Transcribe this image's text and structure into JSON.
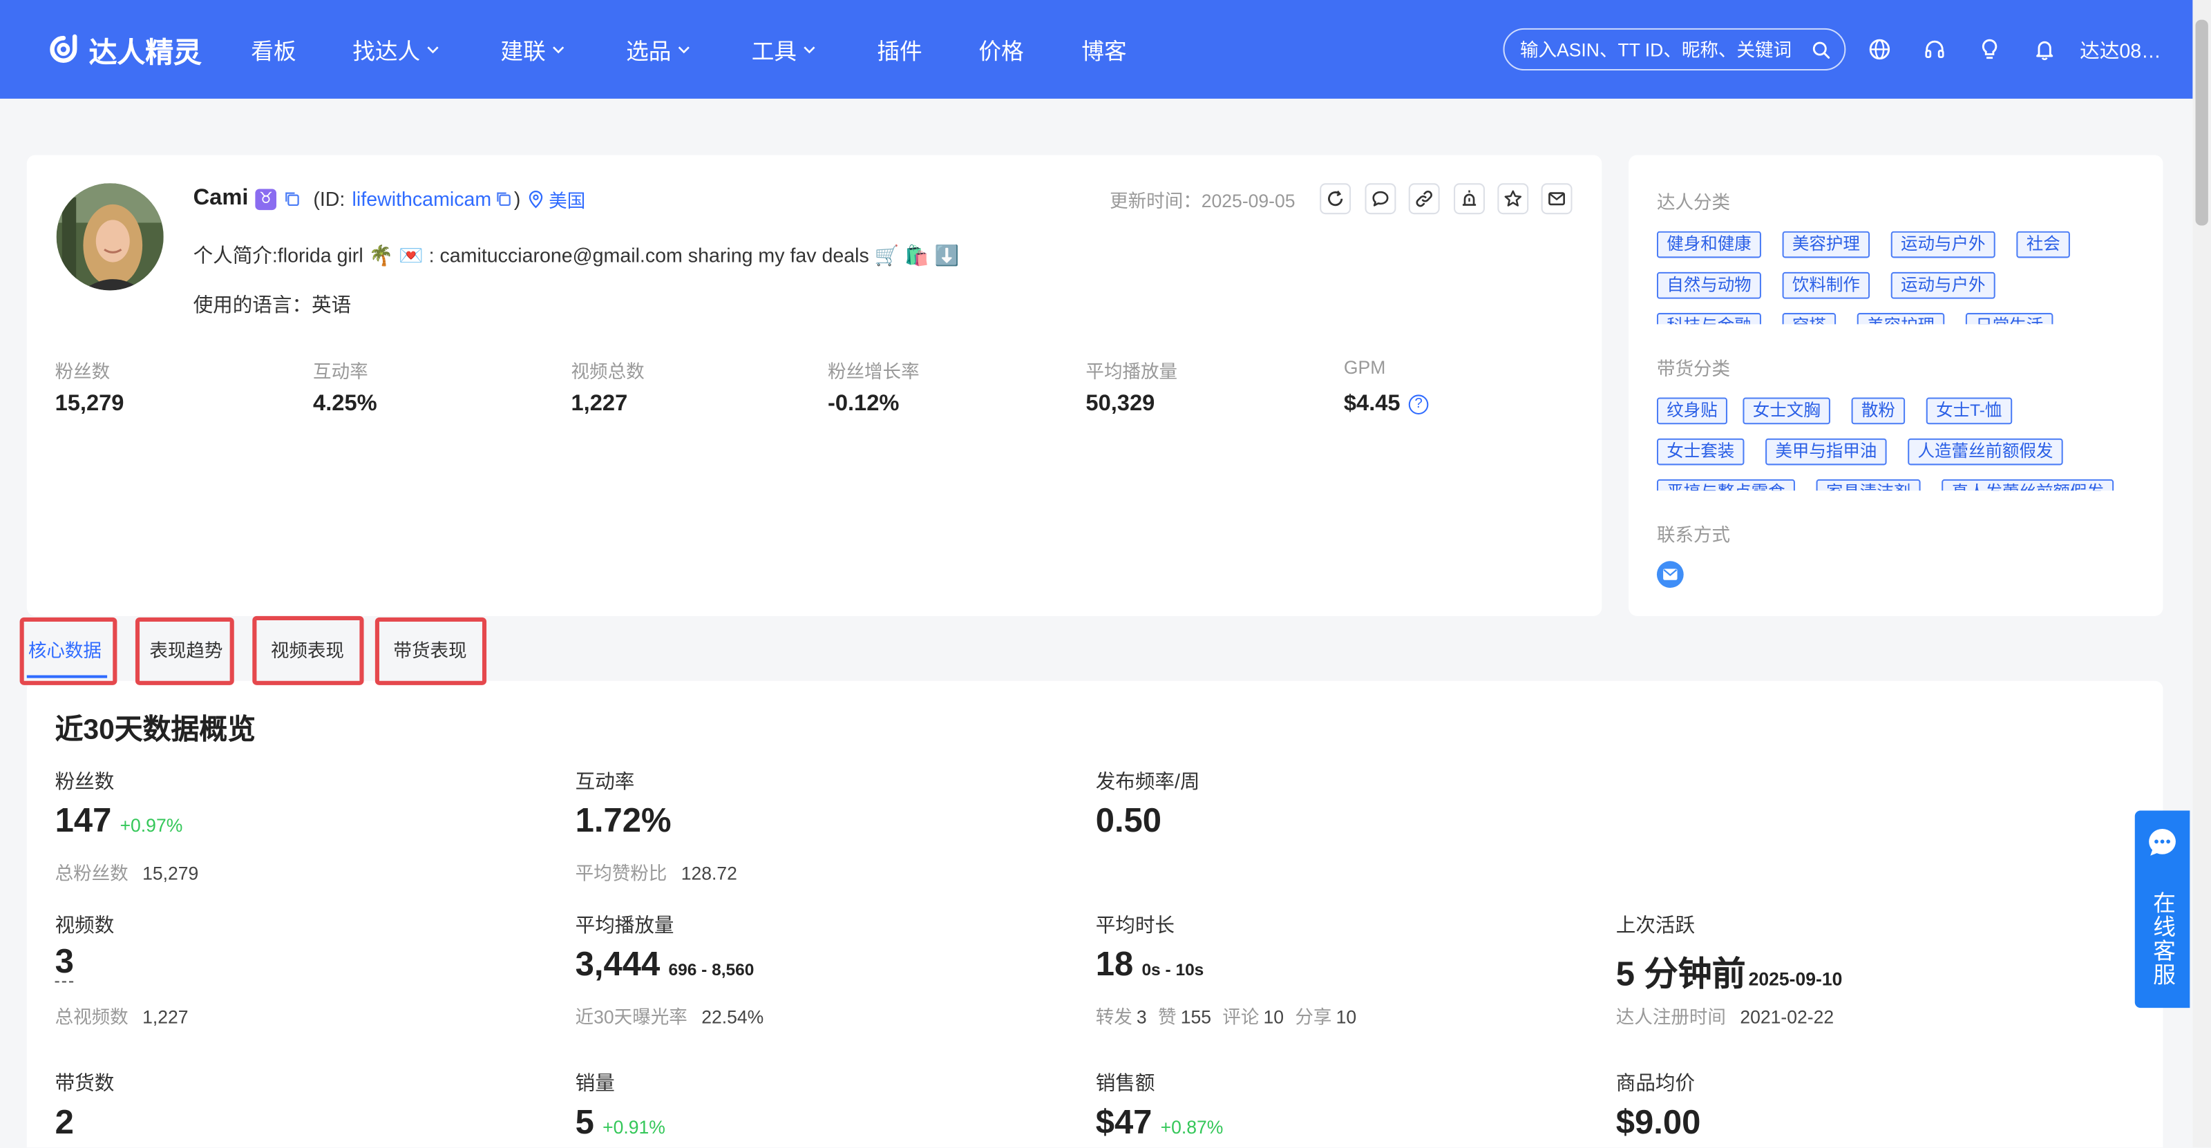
{
  "colors": {
    "header_bg": "#3f6ff5",
    "accent": "#2f6bff",
    "tag_bg": "#eef3ff",
    "positive": "#34c759",
    "annotation": "#e5484d",
    "page_bg": "#f5f6f8"
  },
  "header": {
    "logo_text": "达人精灵",
    "nav": [
      {
        "label": "看板"
      },
      {
        "label": "找达人",
        "icon": "chevron-down-icon"
      },
      {
        "label": "建联",
        "icon": "chevron-down-icon"
      },
      {
        "label": "选品",
        "icon": "chevron-down-icon"
      },
      {
        "label": "工具",
        "icon": "chevron-down-icon"
      },
      {
        "label": "插件"
      },
      {
        "label": "价格"
      },
      {
        "label": "博客"
      }
    ],
    "search_placeholder": "输入ASIN、TT ID、昵称、关键词",
    "icons": [
      "search-icon",
      "globe-icon",
      "headset-icon",
      "lightbulb-icon",
      "bell-icon"
    ],
    "user_name": "达达08…"
  },
  "profile": {
    "name": "Cami",
    "zodiac": "♉",
    "id_open": "(ID:",
    "id": "lifewithcamicam",
    "id_close": ")",
    "location": "美国",
    "update_label": "更新时间：",
    "update_time": "2025-09-05",
    "actions": [
      "refresh-icon",
      "comment-icon",
      "link-icon",
      "alert-icon",
      "star-icon",
      "mail-icon"
    ],
    "bio": "个人简介:florida girl 🌴 💌 : camitucciarone@gmail.com sharing my fav deals 🛒 🛍️ ⬇️",
    "language_label": "使用的语言：",
    "language": "英语",
    "stats": [
      {
        "label": "粉丝数",
        "value": "15,279"
      },
      {
        "label": "互动率",
        "value": "4.25%"
      },
      {
        "label": "视频总数",
        "value": "1,227"
      },
      {
        "label": "粉丝增长率",
        "value": "-0.12%"
      },
      {
        "label": "平均播放量",
        "value": "50,329"
      },
      {
        "label": "GPM",
        "value": "$4.45",
        "help": "?"
      }
    ]
  },
  "sidebar": {
    "creator_category_label": "达人分类",
    "creator_categories": [
      "健身和健康",
      "美容护理",
      "运动与户外",
      "社会",
      "自然与动物",
      "饮料制作",
      "运动与户外",
      "科技与金融",
      "穿搭",
      "美容护理",
      "日常生活"
    ],
    "product_category_label": "带货分类",
    "product_categories": [
      "纹身贴",
      "女士文胸",
      "散粉",
      "女士T-恤",
      "女士套装",
      "美甲与指甲油",
      "人造蕾丝前额假发",
      "恶搞与整点零食",
      "家具清洁剂",
      "真人发蕾丝前额假发"
    ],
    "contact_label": "联系方式"
  },
  "tabs": [
    {
      "label": "核心数据",
      "active": true
    },
    {
      "label": "表现趋势",
      "active": false
    },
    {
      "label": "视频表现",
      "active": false
    },
    {
      "label": "带货表现",
      "active": false
    }
  ],
  "overview": {
    "title": "近30天数据概览",
    "followers": {
      "label": "粉丝数",
      "value": "147",
      "change": "+0.97%",
      "sub_label": "总粉丝数",
      "sub_value": "15,279"
    },
    "engagement": {
      "label": "互动率",
      "value": "1.72%",
      "sub_label": "平均赞粉比",
      "sub_value": "128.72"
    },
    "post_frequency": {
      "label": "发布频率/周",
      "value": "0.50"
    },
    "videos": {
      "label": "视频数",
      "value": "3",
      "sub_label": "总视频数",
      "sub_value": "1,227"
    },
    "avg_views": {
      "label": "平均播放量",
      "value": "3,444",
      "range": "696 - 8,560",
      "sub_label": "近30天曝光率",
      "sub_value": "22.54%"
    },
    "avg_duration": {
      "label": "平均时长",
      "value": "18",
      "range": "0s - 10s",
      "reposts_label": "转发",
      "reposts": "3",
      "likes_label": "赞",
      "likes": "155",
      "comments_label": "评论",
      "comments": "10",
      "shares_label": "分享",
      "shares": "10"
    },
    "last_active": {
      "label": "上次活跃",
      "value": "5 分钟前",
      "date": "2025-09-10",
      "sub_label": "达人注册时间",
      "sub_value": "2021-02-22"
    },
    "products": {
      "label": "带货数",
      "value": "2"
    },
    "sales": {
      "label": "销量",
      "value": "5",
      "change": "+0.91%"
    },
    "revenue": {
      "label": "销售额",
      "value": "$47",
      "change": "+0.87%"
    },
    "avg_price": {
      "label": "商品均价",
      "value": "$9.00"
    }
  },
  "service": {
    "label": "在线客服"
  }
}
